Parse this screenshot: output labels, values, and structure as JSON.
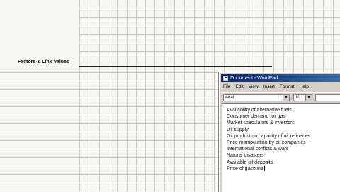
{
  "spreadsheet": {
    "label": "Factors & Link Values"
  },
  "wordpad": {
    "title": "Document - WordPad",
    "menu": [
      "File",
      "Edit",
      "View",
      "Insert",
      "Format",
      "Help"
    ],
    "font": "Arial",
    "size": "10",
    "script": "",
    "lines": [
      "Availability of alternative fuels",
      "Consumer demand for gas",
      "Market speculators & investors",
      "Oil supply",
      "Oil production capacity of oil refineries",
      "Price manipulation by oil companies",
      "International conficts & wars",
      "Natural disasters",
      "Available oil deposits",
      "Price of gasoline"
    ]
  }
}
